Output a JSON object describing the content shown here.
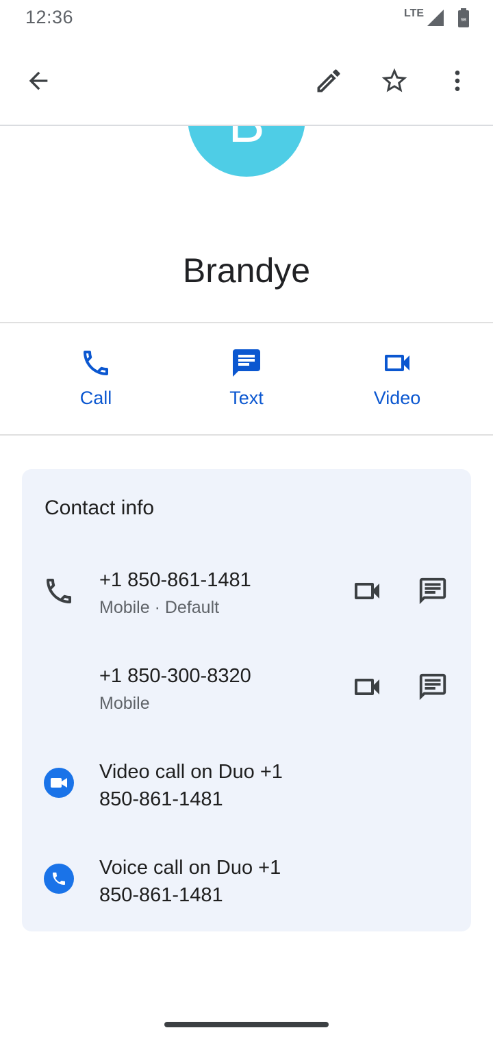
{
  "status": {
    "time": "12:36",
    "network": "LTE",
    "battery_level": "98"
  },
  "toolbar": {
    "back_icon": "arrow-back-icon",
    "edit_icon": "pencil-icon",
    "star_icon": "star-outline-icon",
    "more_icon": "more-vert-icon"
  },
  "contact": {
    "avatar_letter": "B",
    "avatar_color": "#4ecde6",
    "name": "Brandye"
  },
  "actions": [
    {
      "label": "Call",
      "icon": "phone-icon"
    },
    {
      "label": "Text",
      "icon": "message-icon"
    },
    {
      "label": "Video",
      "icon": "videocam-icon"
    }
  ],
  "contact_info": {
    "title": "Contact info",
    "phones": [
      {
        "number": "+1 850-861-1481",
        "label": "Mobile · Default"
      },
      {
        "number": "+1 850-300-8320",
        "label": "Mobile"
      }
    ],
    "duo": [
      {
        "line1": "Video call on Duo +1",
        "line2": "850-861-1481",
        "icon": "duo-video-icon"
      },
      {
        "line1": "Voice call on Duo +1",
        "line2": "850-861-1481",
        "icon": "duo-phone-icon"
      }
    ]
  },
  "colors": {
    "accent": "#0b57d0",
    "card_bg": "#eff3fb",
    "duo_blue": "#1a73e8"
  }
}
